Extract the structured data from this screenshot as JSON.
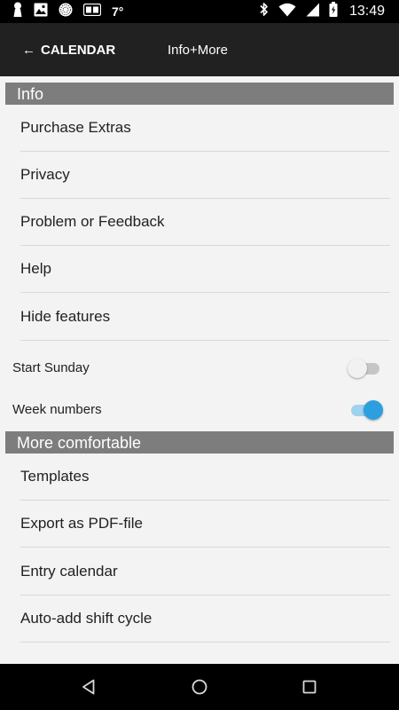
{
  "status_bar": {
    "temperature": "7°",
    "time": "13:49",
    "left_icons": [
      "keyhole-icon",
      "image-icon",
      "sphere-icon",
      "ge-badge-icon"
    ],
    "right_icons": [
      "bluetooth-icon",
      "wifi-icon",
      "signal-icon",
      "battery-icon"
    ]
  },
  "app_bar": {
    "back_label": "CALENDAR",
    "back_arrow": "←",
    "title": "Info+More"
  },
  "sections": {
    "info": {
      "header": "Info",
      "items": [
        "Purchase Extras",
        "Privacy",
        "Problem or Feedback",
        "Help",
        "Hide features"
      ]
    },
    "toggles": [
      {
        "label": "Start Sunday",
        "on": false
      },
      {
        "label": "Week numbers",
        "on": true
      }
    ],
    "more": {
      "header": "More comfortable",
      "items": [
        "Templates",
        "Export as PDF-file",
        "Entry calendar",
        "Auto-add shift cycle"
      ]
    }
  },
  "colors": {
    "app_bar": "#212121",
    "section_header": "#7d7d7d",
    "content_bg": "#f3f3f3",
    "switch_on": "#2d9fe0"
  },
  "nav_bar": {
    "buttons": [
      "back-icon",
      "home-icon",
      "recents-icon"
    ]
  }
}
